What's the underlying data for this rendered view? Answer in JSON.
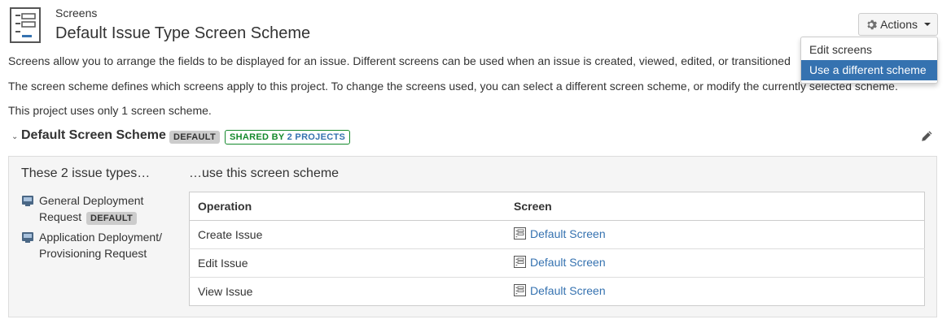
{
  "header": {
    "breadcrumb": "Screens",
    "title": "Default Issue Type Screen Scheme",
    "page_icon": "screen-scheme-icon"
  },
  "actions": {
    "label": "Actions",
    "icon": "gear-icon",
    "menu": [
      {
        "label": "Edit screens",
        "active": false
      },
      {
        "label": "Use a different scheme",
        "active": true
      }
    ]
  },
  "description": {
    "line1": "Screens allow you to arrange the fields to be displayed for an issue. Different screens can be used when an issue is created, viewed, edited, or transitioned",
    "line2": "The screen scheme defines which screens apply to this project. To change the screens used, you can select a different screen scheme, or modify the currently selected scheme.",
    "line3": "This project uses only 1 screen scheme."
  },
  "scheme": {
    "name": "Default Screen Scheme",
    "default_badge": "DEFAULT",
    "shared_prefix": "SHARED BY ",
    "shared_count": "2 PROJECTS"
  },
  "panel": {
    "issue_types_heading": "These 2 issue types…",
    "screen_scheme_heading": "…use this screen scheme",
    "issue_types": [
      {
        "name": "General Deployment Request",
        "badge": "DEFAULT"
      },
      {
        "name": "Application Deployment/Provisioning Request",
        "badge": ""
      }
    ],
    "table": {
      "col_operation": "Operation",
      "col_screen": "Screen",
      "rows": [
        {
          "operation": "Create Issue",
          "screen": "Default Screen"
        },
        {
          "operation": "Edit Issue",
          "screen": "Default Screen"
        },
        {
          "operation": "View Issue",
          "screen": "Default Screen"
        }
      ]
    }
  },
  "colors": {
    "link": "#3572b0",
    "menu_highlight": "#3572b0",
    "shared_green": "#14892c",
    "panel_bg": "#f5f5f5"
  }
}
